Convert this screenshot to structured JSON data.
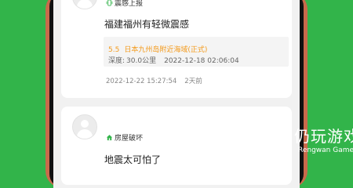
{
  "feed": {
    "posts": [
      {
        "tag": "震感上报",
        "tag_icon": "phone-vibrate-icon",
        "tag_icon_color": "#32b44a",
        "text": "福建福州有轻微震感",
        "quake": {
          "magnitude": "5.5",
          "location": "日本九州岛附近海域(正式)",
          "depth_label": "深度:",
          "depth_value": "30.0公里",
          "time": "2022-12-18 02:06:04"
        },
        "timestamp": "2022-12-22 15:27:54",
        "relative_time": "2天前"
      },
      {
        "tag": "房屋破坏",
        "tag_icon": "house-icon",
        "tag_icon_color": "#32b44a",
        "text": "地震太可怕了"
      }
    ]
  },
  "colors": {
    "background": "#32b44a",
    "accent": "#f39a1b",
    "phone_frame": "#c96a4b"
  },
  "watermark": {
    "brand_cn": "仍玩游戏",
    "brand_en": "Rengwan Games"
  }
}
